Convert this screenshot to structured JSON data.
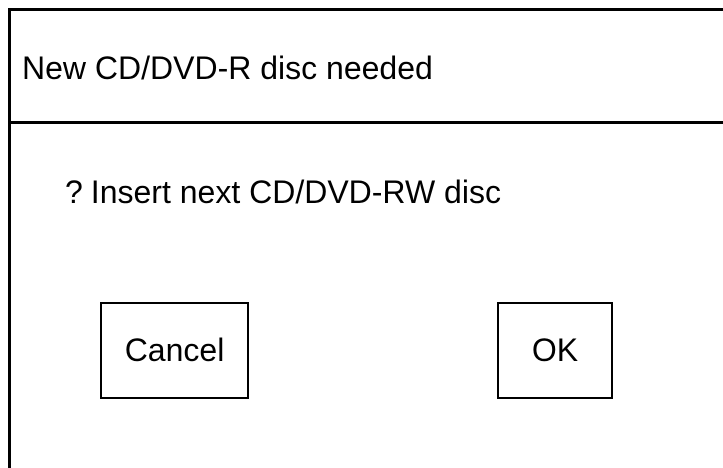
{
  "dialog": {
    "title": "New CD/DVD-R disc needed",
    "message_icon": "?",
    "message_icon_name": "question-icon",
    "message": "Insert next CD/DVD-RW disc",
    "buttons": {
      "cancel_label": "Cancel",
      "ok_label": "OK"
    }
  }
}
